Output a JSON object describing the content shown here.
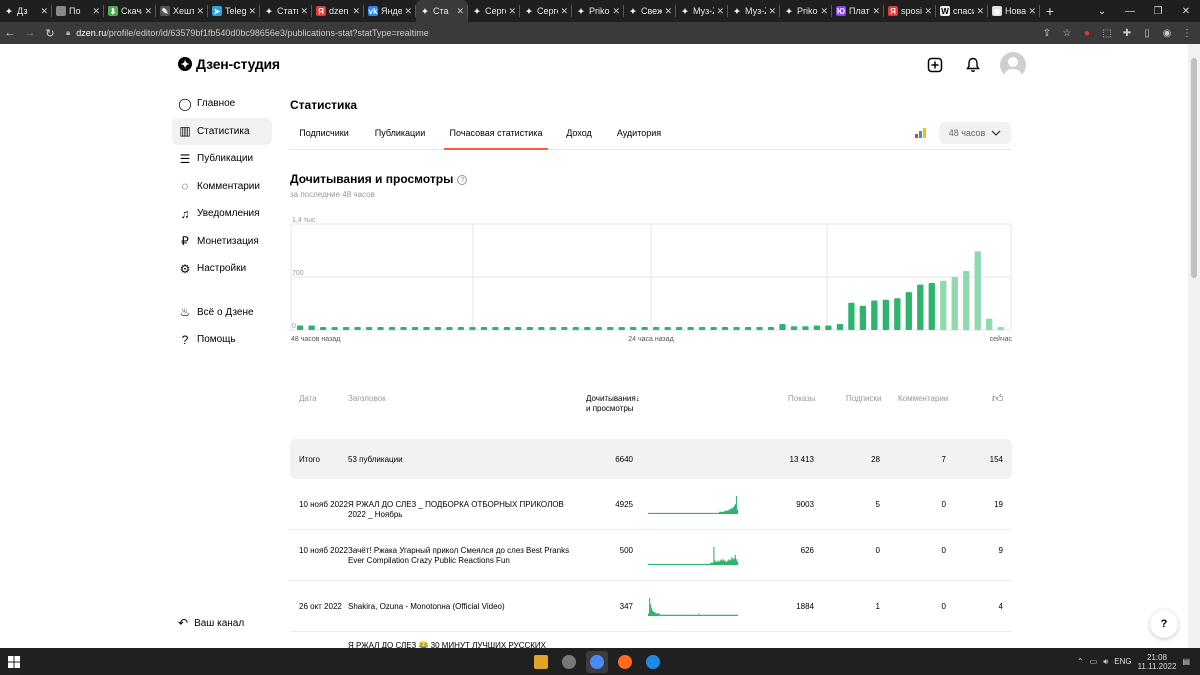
{
  "browser": {
    "tabs": [
      {
        "label": "Дз",
        "fav": "zen",
        "color": "#000"
      },
      {
        "label": "По",
        "fav": "apple",
        "color": "#888"
      },
      {
        "label": "Скачат",
        "fav": "download",
        "color": "#4caf50"
      },
      {
        "label": "Хештег",
        "fav": "hashtag",
        "color": "#555"
      },
      {
        "label": "Telegra",
        "fav": "telegram",
        "color": "#2aa3df"
      },
      {
        "label": "Статист",
        "fav": "zen",
        "color": "#000"
      },
      {
        "label": "dzen —",
        "fav": "yandex",
        "color": "#e53935"
      },
      {
        "label": "Яндекс",
        "fav": "vk",
        "color": "#2787f5"
      },
      {
        "label": "Ста",
        "fav": "zen",
        "color": "#000",
        "active": true
      },
      {
        "label": "Сергей",
        "fav": "zen",
        "color": "#000"
      },
      {
        "label": "Сергей",
        "fav": "zen",
        "color": "#000"
      },
      {
        "label": "Prikolis",
        "fav": "zen",
        "color": "#000"
      },
      {
        "label": "Свежи",
        "fav": "zen",
        "color": "#000"
      },
      {
        "label": "Муз-Z",
        "fav": "zen",
        "color": "#000"
      },
      {
        "label": "Муз-Z",
        "fav": "zen",
        "color": "#000"
      },
      {
        "label": "Prikolis",
        "fav": "zen",
        "color": "#000"
      },
      {
        "label": "Платеж",
        "fav": "yoomoney",
        "color": "#8b3ffd"
      },
      {
        "label": "sposib",
        "fav": "yandex",
        "color": "#e53935"
      },
      {
        "label": "спасиб",
        "fav": "wiki",
        "color": "#eee"
      },
      {
        "label": "Новая",
        "fav": "chrome",
        "color": "#ddd"
      }
    ],
    "url_host": "dzen.ru",
    "url_path": "/profile/editor/id/63579bf1fb540d0bc98656e3/publications-stat?statType=realtime"
  },
  "app": {
    "logo": "Дзен-студия"
  },
  "sidebar": {
    "items": [
      {
        "label": "Главное",
        "icon": "home-icon",
        "glyph": "◯"
      },
      {
        "label": "Статистика",
        "icon": "stats-icon",
        "glyph": "▥",
        "active": true
      },
      {
        "label": "Публикации",
        "icon": "publications-icon",
        "glyph": "☰"
      },
      {
        "label": "Комментарии",
        "icon": "comments-icon",
        "glyph": "◌"
      },
      {
        "label": "Уведомления",
        "icon": "bell-icon",
        "glyph": "♫"
      },
      {
        "label": "Монетизация",
        "icon": "ruble-icon",
        "glyph": "₽"
      },
      {
        "label": "Настройки",
        "icon": "gear-icon",
        "glyph": "⚙"
      }
    ],
    "items2": [
      {
        "label": "Всё о Дзене",
        "icon": "flame-icon",
        "glyph": "♨"
      },
      {
        "label": "Помощь",
        "icon": "help-icon",
        "glyph": "?"
      }
    ],
    "channel": "Ваш канал"
  },
  "stats": {
    "title": "Статистика",
    "tabs": [
      {
        "label": "Подписчики"
      },
      {
        "label": "Публикации"
      },
      {
        "label": "Почасовая статистика",
        "active": true
      },
      {
        "label": "Доход"
      },
      {
        "label": "Аудитория"
      }
    ],
    "period": "48 часов",
    "section_title": "Дочитывания и просмотры",
    "section_sub": "за последние 48 часов"
  },
  "chart_data": {
    "type": "bar",
    "y_ticks": [
      "0",
      "700",
      "1,4 тыс"
    ],
    "ylim": [
      0,
      1400
    ],
    "x_labels": [
      "48 часов назад",
      "24 часа назад",
      "сейчас"
    ],
    "values": [
      60,
      60,
      40,
      30,
      30,
      30,
      30,
      30,
      30,
      30,
      30,
      30,
      30,
      30,
      30,
      30,
      30,
      30,
      30,
      30,
      30,
      30,
      30,
      40,
      30,
      30,
      30,
      30,
      30,
      30,
      30,
      30,
      40,
      30,
      30,
      30,
      30,
      30,
      30,
      30,
      30,
      30,
      80,
      50,
      50,
      60,
      60,
      80,
      360,
      320,
      390,
      400,
      420,
      500,
      600,
      620,
      650,
      700,
      780,
      1040,
      150,
      20
    ],
    "light_from": 56
  },
  "table": {
    "headers": {
      "date": "Дата",
      "title": "Заголовок",
      "reads": "Дочитывания и просмотры",
      "reads_line1": "Дочитывания",
      "reads_line2": "и просмотры",
      "impressions": "Показы",
      "subs": "Подписки",
      "comments": "Комментарии",
      "likes_icon": "thumbs-up-icon"
    },
    "total": {
      "label": "Итого",
      "pubs": "53 публикации",
      "reads": "6640",
      "impressions": "13 413",
      "subs": "28",
      "comments": "7",
      "likes": "154"
    },
    "rows": [
      {
        "date": "10 нояб 2022",
        "title": "Я РЖАЛ ДО СЛЕЗ _ ПОДБОРКА ОТБОРНЫХ ПРИКОЛОВ 2022 _ Ноябрь",
        "reads": "4925",
        "impressions": "9003",
        "subs": "5",
        "comments": "0",
        "likes": "19",
        "spark": [
          1,
          1,
          1,
          1,
          1,
          1,
          1,
          1,
          1,
          1,
          1,
          1,
          1,
          1,
          1,
          1,
          1,
          1,
          1,
          1,
          1,
          1,
          1,
          1,
          1,
          1,
          1,
          1,
          1,
          1,
          1,
          1,
          1,
          1,
          1,
          1,
          1,
          1,
          1,
          1,
          1,
          1,
          1,
          1,
          1,
          1,
          1,
          1,
          1,
          1,
          1,
          1,
          1,
          1,
          1,
          1,
          1,
          1,
          1,
          1,
          1,
          1,
          1,
          1,
          1,
          1,
          1,
          1,
          2,
          2,
          2,
          2,
          2,
          3,
          3,
          3,
          3,
          4,
          4,
          5,
          5,
          6,
          7,
          9,
          16,
          4
        ]
      },
      {
        "date": "10 нояб 2022",
        "title": "Зачёт! Ржака Угарный прикол Смеялся до слез Best Pranks Ever Compilation Crazy Public Reactions Fun",
        "reads": "500",
        "impressions": "626",
        "subs": "0",
        "comments": "0",
        "likes": "9",
        "spark": [
          1,
          1,
          1,
          1,
          1,
          1,
          1,
          1,
          1,
          1,
          1,
          1,
          1,
          1,
          1,
          1,
          1,
          1,
          1,
          1,
          1,
          1,
          1,
          1,
          1,
          1,
          1,
          1,
          1,
          1,
          1,
          1,
          1,
          1,
          1,
          1,
          1,
          1,
          1,
          1,
          1,
          1,
          1,
          1,
          1,
          1,
          1,
          1,
          1,
          1,
          1,
          1,
          1,
          1,
          1,
          1,
          1,
          1,
          2,
          2,
          2,
          16,
          4,
          3,
          3,
          4,
          3,
          4,
          5,
          4,
          5,
          4,
          3,
          3,
          4,
          5,
          4,
          5,
          7,
          5,
          6,
          9,
          5,
          3
        ]
      },
      {
        "date": "26 окт 2022",
        "title": "Shakira, Ozuna - Monotonнa (Official Video)",
        "reads": "347",
        "impressions": "1884",
        "subs": "1",
        "comments": "0",
        "likes": "4",
        "spark": [
          2,
          14,
          9,
          6,
          4,
          3,
          3,
          2,
          2,
          2,
          2,
          1,
          1,
          1,
          1,
          1,
          1,
          1,
          1,
          1,
          1,
          1,
          1,
          1,
          1,
          1,
          1,
          1,
          1,
          1,
          1,
          1,
          1,
          1,
          1,
          1,
          1,
          1,
          1,
          1,
          1,
          1,
          1,
          1,
          1,
          1,
          1,
          2,
          1,
          1,
          1,
          1,
          1,
          1,
          1,
          1,
          1,
          1,
          1,
          1,
          1,
          1,
          1,
          1,
          1,
          1,
          1,
          1,
          1,
          1,
          1,
          1,
          1,
          1,
          1,
          1,
          1,
          1,
          1,
          1,
          1,
          1,
          1,
          1
        ]
      },
      {
        "date": "",
        "title": "Я РЖАЛ ДО СЛЕЗ 😂 30 МИНУТ ЛУЧШИХ РУССКИХ",
        "reads": "",
        "impressions": "",
        "subs": "",
        "comments": "",
        "likes": "",
        "spark": []
      }
    ]
  },
  "help_label": "?",
  "taskbar": {
    "lang": "ENG",
    "time": "21:08",
    "date": "11.11.2022",
    "apps": [
      {
        "name": "file-explorer-icon",
        "color": "#e0a526"
      },
      {
        "name": "app-icon",
        "color": "#777"
      },
      {
        "name": "chrome-icon",
        "color": "#4c8bf5",
        "active": true
      },
      {
        "name": "firefox-icon",
        "color": "#ff6b1a"
      },
      {
        "name": "vscode-icon",
        "color": "#1e88e5"
      }
    ]
  },
  "colors": {
    "accent": "#ff5c33",
    "bar_dark": "#2db56d",
    "bar_light": "#8ed9ad",
    "spark": "#2db56d"
  }
}
